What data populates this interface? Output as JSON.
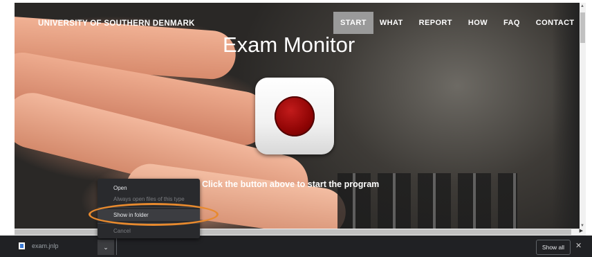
{
  "site": {
    "brand": "UNIVERSITY OF SOUTHERN DENMARK",
    "nav": [
      {
        "label": "START",
        "active": true
      },
      {
        "label": "WHAT",
        "active": false
      },
      {
        "label": "REPORT",
        "active": false
      },
      {
        "label": "HOW",
        "active": false
      },
      {
        "label": "FAQ",
        "active": false
      },
      {
        "label": "CONTACT",
        "active": false
      }
    ],
    "title": "Exam Monitor",
    "record_button_icon": "record-icon",
    "hint": "Click the button above to start the program"
  },
  "context_menu": {
    "items": [
      {
        "label": "Open",
        "enabled": true
      },
      {
        "label": "Always open files of this type",
        "enabled": false
      },
      {
        "label": "Show in folder",
        "enabled": true,
        "highlighted": true
      },
      {
        "label": "Cancel",
        "enabled": false
      }
    ],
    "annotation_color": "#e88a2e"
  },
  "download_bar": {
    "file_name": "exam.jnlp",
    "file_icon": "file-icon",
    "menu_icon": "chevron-down-icon",
    "show_all_label": "Show all",
    "close_icon": "close-icon"
  }
}
